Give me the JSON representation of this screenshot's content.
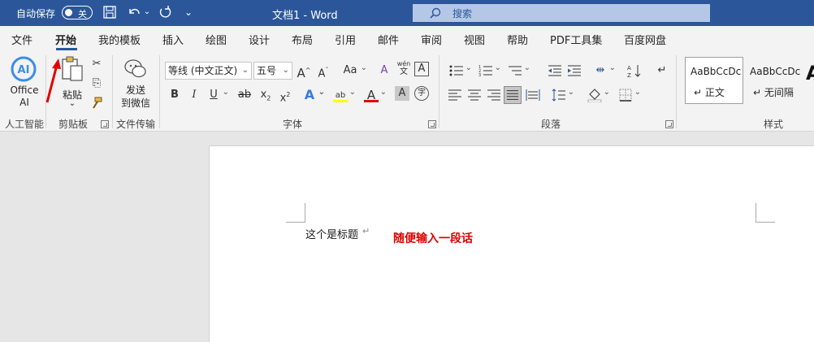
{
  "titlebar": {
    "autosave_label": "自动保存",
    "autosave_state": "关",
    "doc_title": "文档1  -  Word",
    "search_placeholder": "搜索",
    "qa_save": "🖫",
    "qa_undo": "↶",
    "qa_redo": "↻",
    "qa_customize": "⌄",
    "bg_color": "#2b579a"
  },
  "tabs": [
    {
      "label": "文件"
    },
    {
      "label": "开始",
      "active": true
    },
    {
      "label": "我的模板"
    },
    {
      "label": "插入"
    },
    {
      "label": "绘图"
    },
    {
      "label": "设计"
    },
    {
      "label": "布局"
    },
    {
      "label": "引用"
    },
    {
      "label": "邮件"
    },
    {
      "label": "审阅"
    },
    {
      "label": "视图"
    },
    {
      "label": "帮助"
    },
    {
      "label": "PDF工具集"
    },
    {
      "label": "百度网盘"
    }
  ],
  "ribbon": {
    "ai": {
      "line1": "Office",
      "line2": "AI",
      "group": "人工智能",
      "badge": "AI"
    },
    "clipboard": {
      "paste": "粘贴",
      "group": "剪贴板"
    },
    "transfer": {
      "line1": "发送",
      "line2": "到微信",
      "group": "文件传输"
    },
    "font": {
      "group": "字体",
      "font_name": "等线 (中文正文)",
      "font_size": "五号",
      "grow": "A",
      "shrink": "A",
      "case": "Aa",
      "clear": "A",
      "phonetic_top": "wén",
      "phonetic_bottom": "文",
      "border_char": "A",
      "bold": "B",
      "italic": "I",
      "underline": "U",
      "strike": "ab",
      "subscript": "x",
      "superscript": "x",
      "effects": "A",
      "highlight": "ab",
      "color": "A",
      "shading": "A",
      "enclose": "字"
    },
    "paragraph": {
      "group": "段落"
    },
    "styles": {
      "group": "样式",
      "items": [
        {
          "sample": "AaBbCcDc",
          "name": "↵ 正文"
        },
        {
          "sample": "AaBbCcDc",
          "name": "↵ 无间隔"
        }
      ],
      "partial": "A"
    }
  },
  "document": {
    "line1": "这个是标题",
    "paragraph_mark": "↵",
    "red_text": "随便输入一段话",
    "red_color": "#e00000"
  }
}
